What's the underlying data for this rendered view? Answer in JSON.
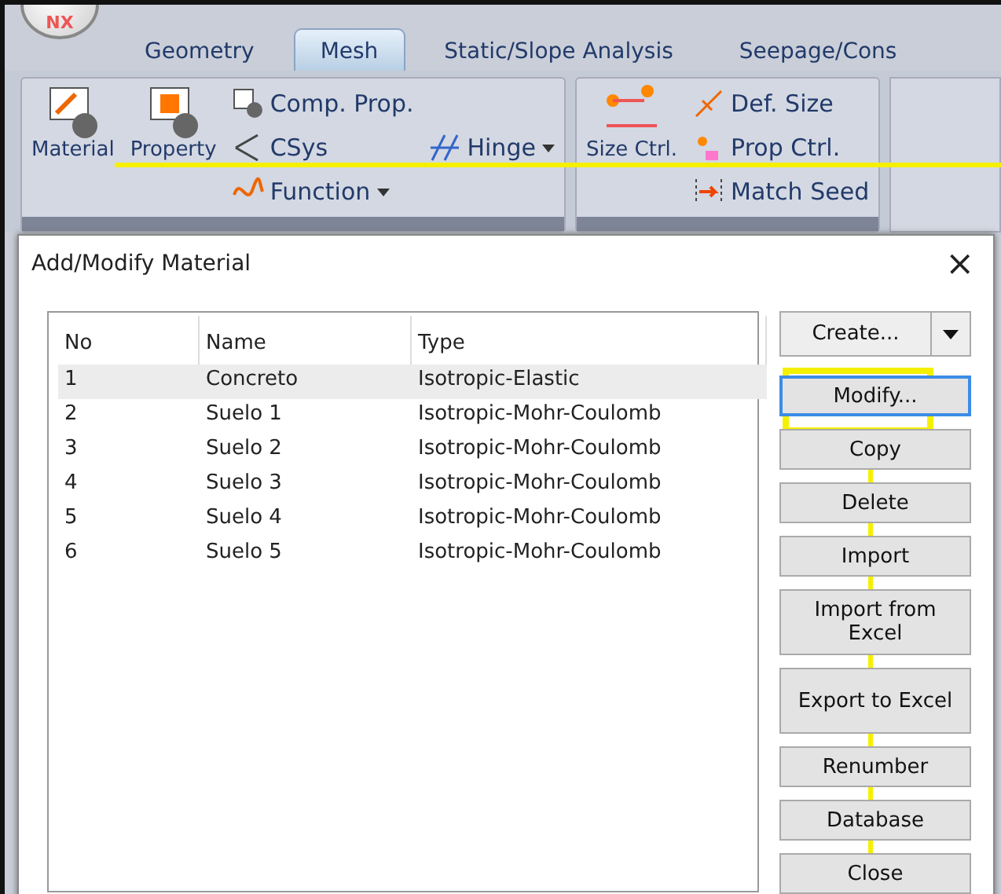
{
  "app_logo": {
    "text": "NX"
  },
  "tabs": [
    {
      "label": "Geometry",
      "selected": false
    },
    {
      "label": "Mesh",
      "selected": true
    },
    {
      "label": "Static/Slope Analysis",
      "selected": false
    },
    {
      "label": "Seepage/Cons",
      "selected": false
    }
  ],
  "ribbon_groups": [
    {
      "large": [
        {
          "label": "Material"
        },
        {
          "label": "Property"
        }
      ],
      "columns": [
        [
          {
            "label": "Comp. Prop.",
            "dropdown": false
          },
          {
            "label": "CSys",
            "dropdown": false
          },
          {
            "label": "Function",
            "dropdown": true
          }
        ],
        [
          {
            "label": "Hinge",
            "dropdown": true
          }
        ]
      ]
    },
    {
      "large": [
        {
          "label": "Size Ctrl."
        }
      ],
      "columns": [
        [
          {
            "label": "Def. Size",
            "dropdown": false
          },
          {
            "label": "Prop Ctrl.",
            "dropdown": false
          },
          {
            "label": "Match Seed",
            "dropdown": false
          }
        ]
      ]
    }
  ],
  "dialog": {
    "title": "Add/Modify Material",
    "close": "×",
    "columns": [
      "No",
      "Name",
      "Type"
    ],
    "rows": [
      {
        "no": "1",
        "name": "Concreto",
        "type": "Isotropic-Elastic",
        "selected": true
      },
      {
        "no": "2",
        "name": "Suelo 1",
        "type": "Isotropic-Mohr-Coulomb",
        "selected": false
      },
      {
        "no": "3",
        "name": "Suelo 2",
        "type": "Isotropic-Mohr-Coulomb",
        "selected": false
      },
      {
        "no": "4",
        "name": "Suelo 3",
        "type": "Isotropic-Mohr-Coulomb",
        "selected": false
      },
      {
        "no": "5",
        "name": "Suelo 4",
        "type": "Isotropic-Mohr-Coulomb",
        "selected": false
      },
      {
        "no": "6",
        "name": "Suelo 5",
        "type": "Isotropic-Mohr-Coulomb",
        "selected": false
      }
    ],
    "buttons": [
      {
        "label": "Create...",
        "kind": "split",
        "focused": false
      },
      {
        "label": "Modify...",
        "kind": "push",
        "focused": true
      },
      {
        "label": "Copy",
        "kind": "push",
        "focused": false
      },
      {
        "label": "Delete",
        "kind": "push",
        "focused": false
      },
      {
        "label": "Import",
        "kind": "push",
        "focused": false
      },
      {
        "label": "Import from Excel",
        "kind": "tall",
        "focused": false
      },
      {
        "label": "Export to Excel",
        "kind": "tall",
        "focused": false
      },
      {
        "label": "Renumber",
        "kind": "push",
        "focused": false
      },
      {
        "label": "Database",
        "kind": "push",
        "focused": false
      },
      {
        "label": "Close",
        "kind": "push",
        "focused": false
      }
    ]
  }
}
